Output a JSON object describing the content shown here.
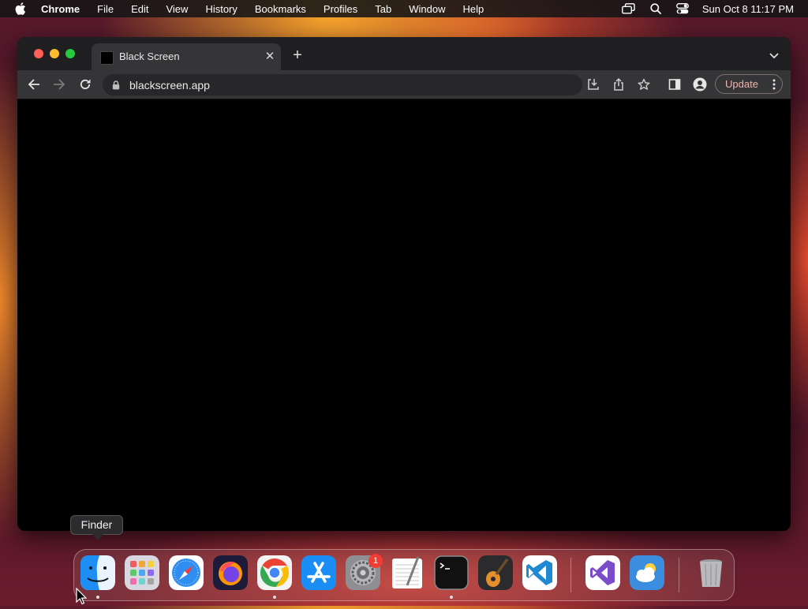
{
  "menubar": {
    "app_name": "Chrome",
    "menus": [
      "File",
      "Edit",
      "View",
      "History",
      "Bookmarks",
      "Profiles",
      "Tab",
      "Window",
      "Help"
    ],
    "status_icons": [
      "screen-mirroring-icon",
      "search-icon",
      "control-center-icon"
    ],
    "clock": "Sun Oct 8  11:17 PM"
  },
  "browser": {
    "tab": {
      "title": "Black Screen",
      "favicon": "black-square-icon"
    },
    "address": "blackscreen.app",
    "update_label": "Update",
    "colors": {
      "page_background": "#000000",
      "update_text": "#f0b3a8"
    }
  },
  "dock": {
    "tooltip": "Finder",
    "apps": [
      {
        "name": "Finder",
        "icon": "finder-icon",
        "running": true
      },
      {
        "name": "Launchpad",
        "icon": "launchpad-icon",
        "running": false
      },
      {
        "name": "Safari",
        "icon": "safari-icon",
        "running": false
      },
      {
        "name": "Firefox",
        "icon": "firefox-icon",
        "running": false
      },
      {
        "name": "Google Chrome",
        "icon": "chrome-icon",
        "running": true
      },
      {
        "name": "App Store",
        "icon": "app-store-icon",
        "running": false
      },
      {
        "name": "System Settings",
        "icon": "system-settings-icon",
        "running": false,
        "badge": "1"
      },
      {
        "name": "TextEdit",
        "icon": "textedit-icon",
        "running": false
      },
      {
        "name": "Terminal",
        "icon": "terminal-icon",
        "running": true
      },
      {
        "name": "GarageBand",
        "icon": "garageband-icon",
        "running": false
      },
      {
        "name": "Visual Studio Code",
        "icon": "vscode-icon",
        "running": false
      },
      {
        "name": "Visual Studio",
        "icon": "visual-studio-icon",
        "running": false
      },
      {
        "name": "Weather",
        "icon": "weather-icon",
        "running": false
      },
      {
        "name": "Trash",
        "icon": "trash-icon",
        "running": false
      }
    ]
  }
}
